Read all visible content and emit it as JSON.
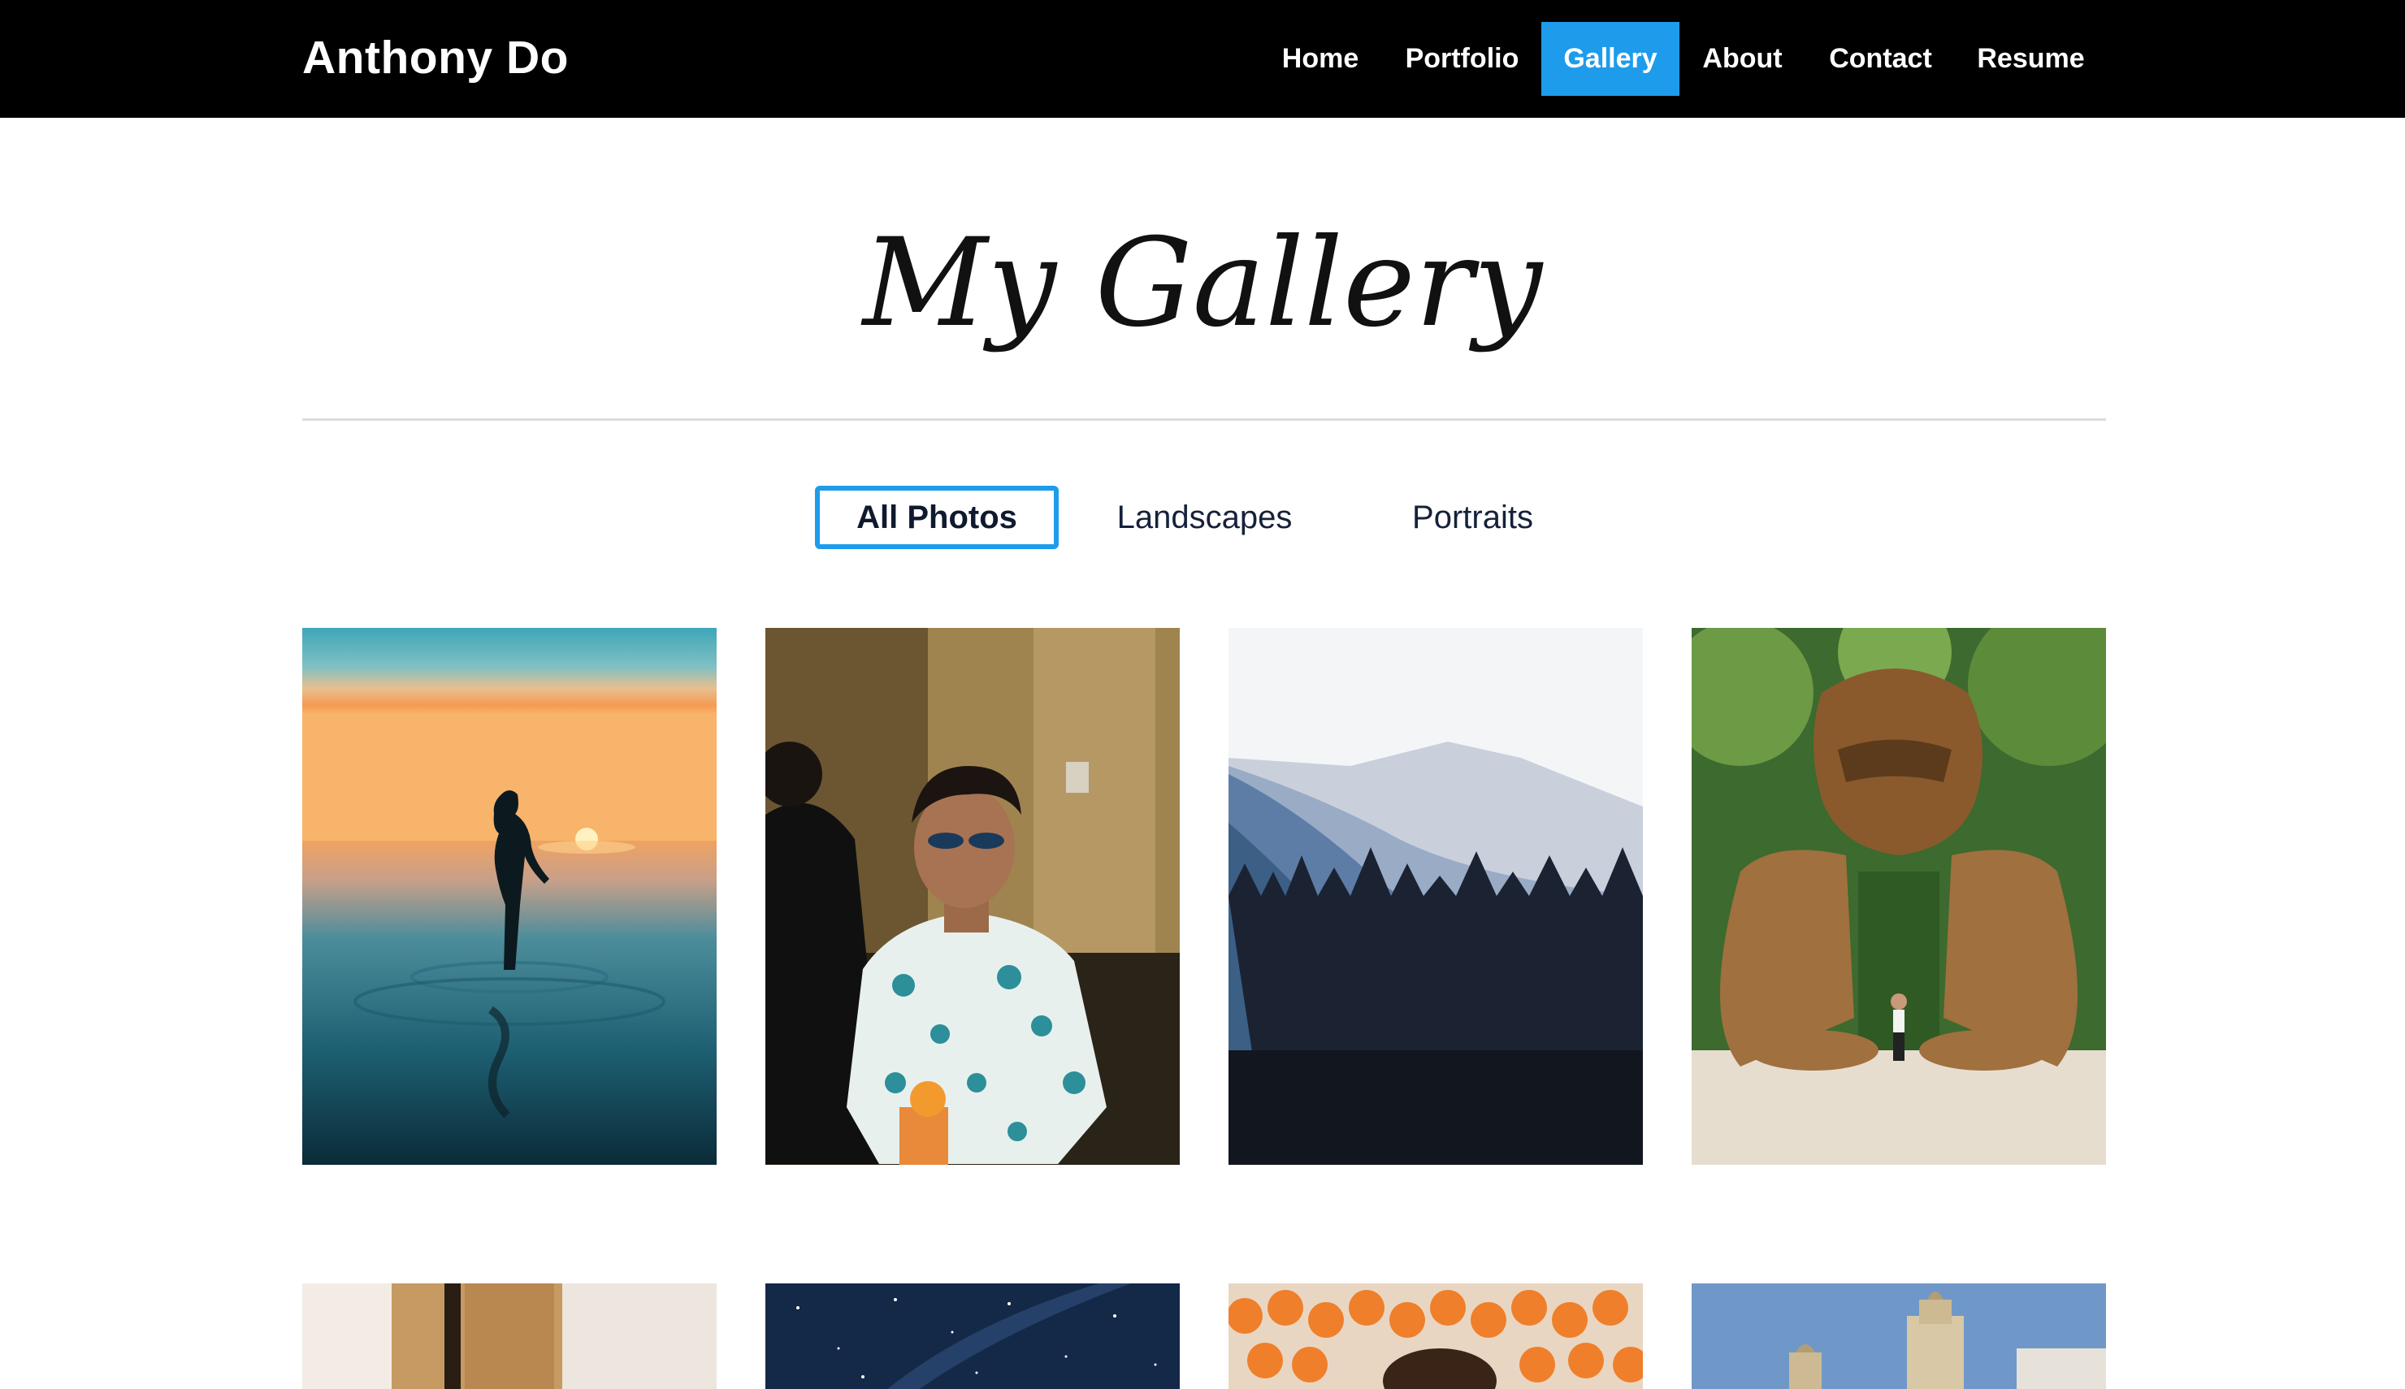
{
  "header": {
    "brand": "Anthony Do",
    "nav": [
      {
        "label": "Home",
        "active": false
      },
      {
        "label": "Portfolio",
        "active": false
      },
      {
        "label": "Gallery",
        "active": true
      },
      {
        "label": "About",
        "active": false
      },
      {
        "label": "Contact",
        "active": false
      },
      {
        "label": "Resume",
        "active": false
      }
    ]
  },
  "gallery": {
    "title": "My Gallery",
    "filters": [
      {
        "label": "All Photos",
        "active": true
      },
      {
        "label": "Landscapes",
        "active": false
      },
      {
        "label": "Portraits",
        "active": false
      }
    ],
    "photos": [
      {
        "subject": "sunset-sea-silhouette"
      },
      {
        "subject": "man-floral-shirt-sunglasses"
      },
      {
        "subject": "misty-mountain-forest"
      },
      {
        "subject": "giant-wooden-sculpture"
      },
      {
        "subject": "curtain-window"
      },
      {
        "subject": "starry-night-sky"
      },
      {
        "subject": "orange-fruits"
      },
      {
        "subject": "church-tower"
      }
    ]
  },
  "colors": {
    "nav_background": "#000000",
    "accent": "#1e9ceb",
    "divider": "#dcdcdc",
    "text_dark": "#16213a"
  }
}
